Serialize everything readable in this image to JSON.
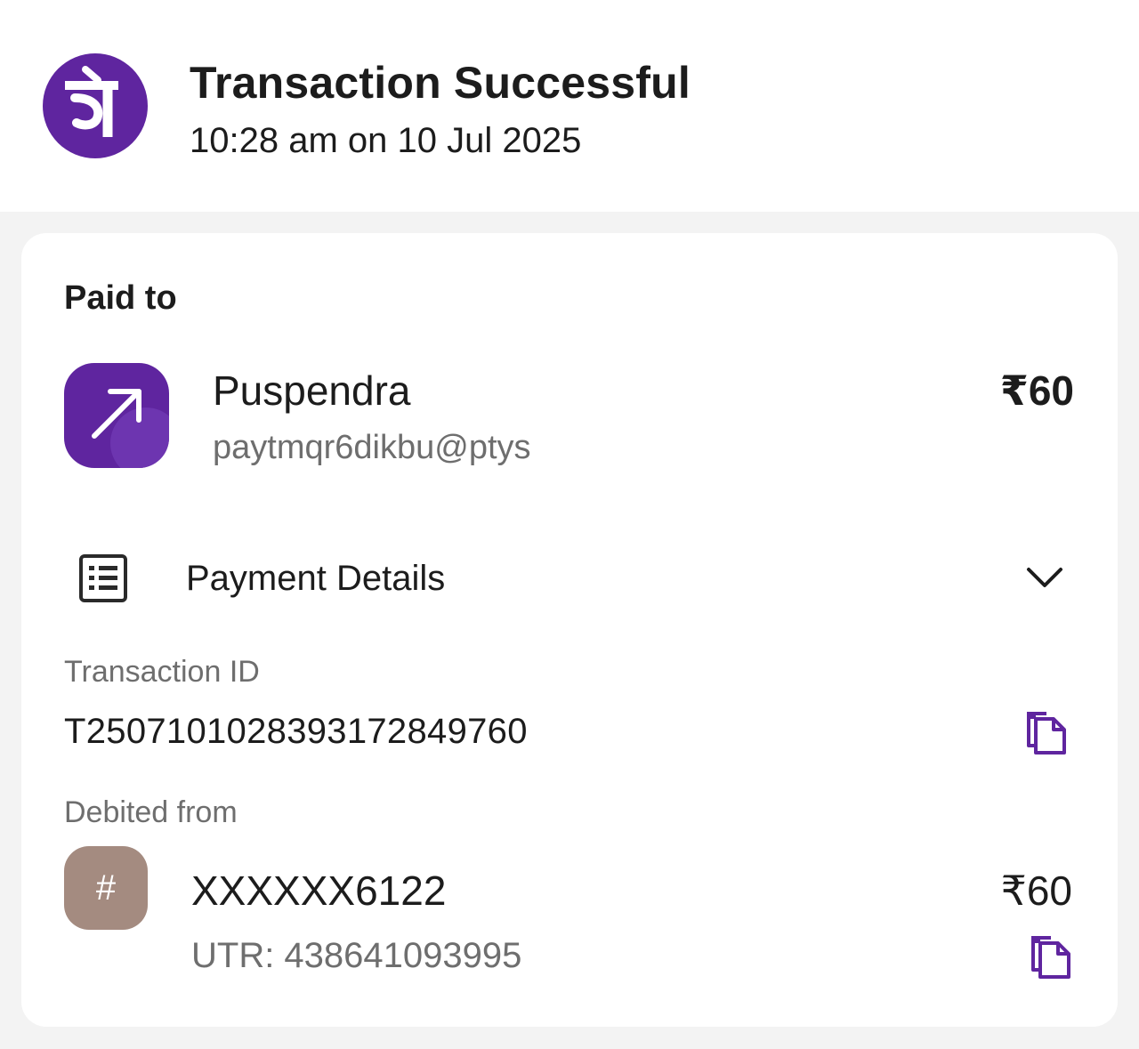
{
  "header": {
    "logo_glyph": "पे",
    "title": "Transaction Successful",
    "datetime": "10:28 am on 10 Jul 2025"
  },
  "paid_to": {
    "label": "Paid to",
    "name": "Puspendra",
    "vpa": "paytmqr6dikbu@ptys",
    "amount": "₹60",
    "icon": "arrow-up-right-icon"
  },
  "payment_details": {
    "label": "Payment Details",
    "icon": "receipt-list-icon",
    "expanded": true,
    "transaction_id_label": "Transaction ID",
    "transaction_id": "T2507101028393172849760",
    "debited_from_label": "Debited from",
    "bank_icon_glyph": "#",
    "account": "XXXXXX6122",
    "utr": "UTR: 438641093995",
    "amount": "₹60"
  },
  "colors": {
    "brand": "#5f259f",
    "bank_icon": "#a48b80",
    "secondary_text": "#6e6e6e"
  }
}
